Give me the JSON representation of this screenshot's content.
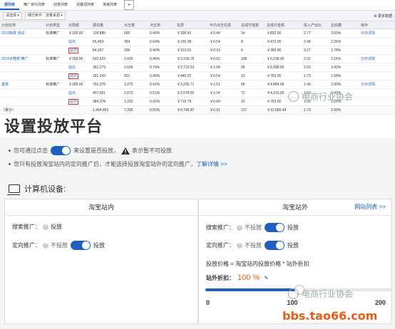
{
  "tabs": [
    {
      "label": "部列表",
      "active": true
    },
    {
      "label": "推广单元列表"
    },
    {
      "label": "创意列表"
    },
    {
      "label": "关键词列表"
    },
    {
      "label": "地域列表"
    }
  ],
  "filters": {
    "sel1": "请选择",
    "sel2": "细分条件：流量来源",
    "btn": "更多数据"
  },
  "table": {
    "headers": [
      "计划名称",
      "计划类型",
      "日限额",
      "展现量",
      "点击量",
      "点击率",
      "花费",
      "平均点击花费",
      "总成交笔数",
      "总成交金额",
      "投入产出比",
      "总收藏",
      "操作"
    ],
    "rows": [
      {
        "name": "2015新款 测试",
        "type": "标准推广",
        "budget": "￥100.00",
        "loc": "",
        "imp": "139,885",
        "clk": "690",
        "ctr": "0.49%",
        "cost": "￥300.41",
        "cpc": "￥0.44",
        "orders": "14",
        "gmv": "￥832.00",
        "roi": "2.77",
        "fav": "2.03%",
        "op": "分日详情"
      },
      {
        "name": "",
        "type": "",
        "budget": "",
        "loc": "站内",
        "boxed": false,
        "imp": "55,403",
        "clk": "354",
        "ctr": "0.64%",
        "cost": "￥190.38",
        "cpc": "￥0.54",
        "orders": "8",
        "gmv": "￥472.00",
        "roi": "2.48",
        "fav": "2.26%",
        "op": ""
      },
      {
        "name": "",
        "type": "",
        "budget": "",
        "loc": "站外",
        "boxed": true,
        "imp": "84,307",
        "clk": "336",
        "ctr": "0.40%",
        "cost": "￥110.03",
        "cpc": "￥0.33",
        "orders": "6",
        "gmv": "￥360.00",
        "roi": "3.27",
        "fav": "1.78%",
        "op": ""
      },
      {
        "name": "2015女鞋款 推广",
        "type": "标准推广",
        "budget": "￥200.00",
        "loc": "",
        "imp": "533,522",
        "clk": "2,430",
        "ctr": "0.46%",
        "cost": "￥3,150.75",
        "cpc": "￥0.62",
        "orders": "108",
        "gmv": "￥6,338.00",
        "roi": "2.01",
        "fav": "3.15%",
        "op": "分日详情"
      },
      {
        "name": "",
        "type": "",
        "budget": "",
        "loc": "站内",
        "boxed": false,
        "imp": "352,279",
        "clk": "2,609",
        "ctr": "0.74%",
        "cost": "￥2,710.53",
        "cpc": "￥1.04",
        "orders": "95",
        "gmv": "￥5,588.00",
        "roi": "2.03",
        "fav": "3.43%",
        "op": ""
      },
      {
        "name": "",
        "type": "",
        "budget": "",
        "loc": "站外",
        "boxed": true,
        "imp": "181,243",
        "clk": "821",
        "ctr": "0.45%",
        "cost": "￥440.22",
        "cpc": "￥0.54",
        "orders": "13",
        "gmv": "￥762.00",
        "roi": "1.73",
        "fav": "1.58%",
        "op": ""
      },
      {
        "name": "夏款",
        "type": "标准推广",
        "budget": "￥300.00",
        "loc": "",
        "imp": "791,376",
        "clk": "3,275",
        "ctr": "0.41%",
        "cost": "￥3,295.71",
        "cpc": "￥1.01",
        "orders": "85",
        "gmv": "￥4,884.99",
        "roi": "1.49",
        "fav": "2.90%",
        "op": "分日详情"
      },
      {
        "name": "",
        "type": "",
        "budget": "",
        "loc": "站内",
        "boxed": false,
        "imp": "407,001",
        "clk": "2,073",
        "ctr": "0.51%",
        "cost": "￥2,578.92",
        "cpc": "￥1.24",
        "orders": "72",
        "gmv": "￥4,131.00",
        "roi": "1.60",
        "fav": "3.47%",
        "op": ""
      },
      {
        "name": "",
        "type": "",
        "budget": "",
        "loc": "站外",
        "boxed": true,
        "imp": "384,378",
        "clk": "1,202",
        "ctr": "0.31%",
        "cost": "￥716.79",
        "cpc": "￥0.60",
        "orders": "13",
        "gmv": "￥753.00",
        "roi": "1.05",
        "fav": "1.65%",
        "op": ""
      }
    ],
    "summary": {
      "name": "（累计）",
      "imp": "1,464,901",
      "clk": "7,395",
      "ctr": "0.50%",
      "cost": "￥6,746.87",
      "cpc": "￥0.91",
      "orders": "217",
      "gmv": "￥12,056.49",
      "roi": "1.79",
      "fav": "2.90%"
    }
  },
  "headline": "设置投放平台",
  "notes": {
    "n1a": "您可通过点击",
    "n1b": "来设置是否投放，",
    "n1c": "表示暂不可投放",
    "n2a": "您只有投放淘宝站内的定向推广后，才能选择投放淘宝站外的定向推广，",
    "n2link": "了解详情 >>"
  },
  "device_label": "计算机设备:",
  "left_panel": {
    "title": "淘宝站内",
    "search_label": "搜索推广：",
    "search_value": "投放",
    "target_label": "定向推广：",
    "target_off": "不投放",
    "target_on": "投放"
  },
  "right_panel": {
    "title": "淘宝站外",
    "link": "网站列表 >>",
    "search_label": "搜索推广：",
    "search_off": "不投放",
    "search_on": "投放",
    "target_label": "定向推广：",
    "target_off": "不投放",
    "target_on": "投放",
    "formula": "投放价格 = 淘宝站内投放价格 * 站外折扣",
    "discount_label": "站外折扣：",
    "discount_value": "100 %",
    "scale_min": "0",
    "scale_mid": "100",
    "scale_max": "200",
    "discount_fraction": 0.5
  },
  "watermark": {
    "text": "电商行业协会"
  },
  "site": "bbs.tao66.com",
  "colors": {
    "accent": "#1f5fbf",
    "site": "#e85d10",
    "box": "#dd3333"
  }
}
